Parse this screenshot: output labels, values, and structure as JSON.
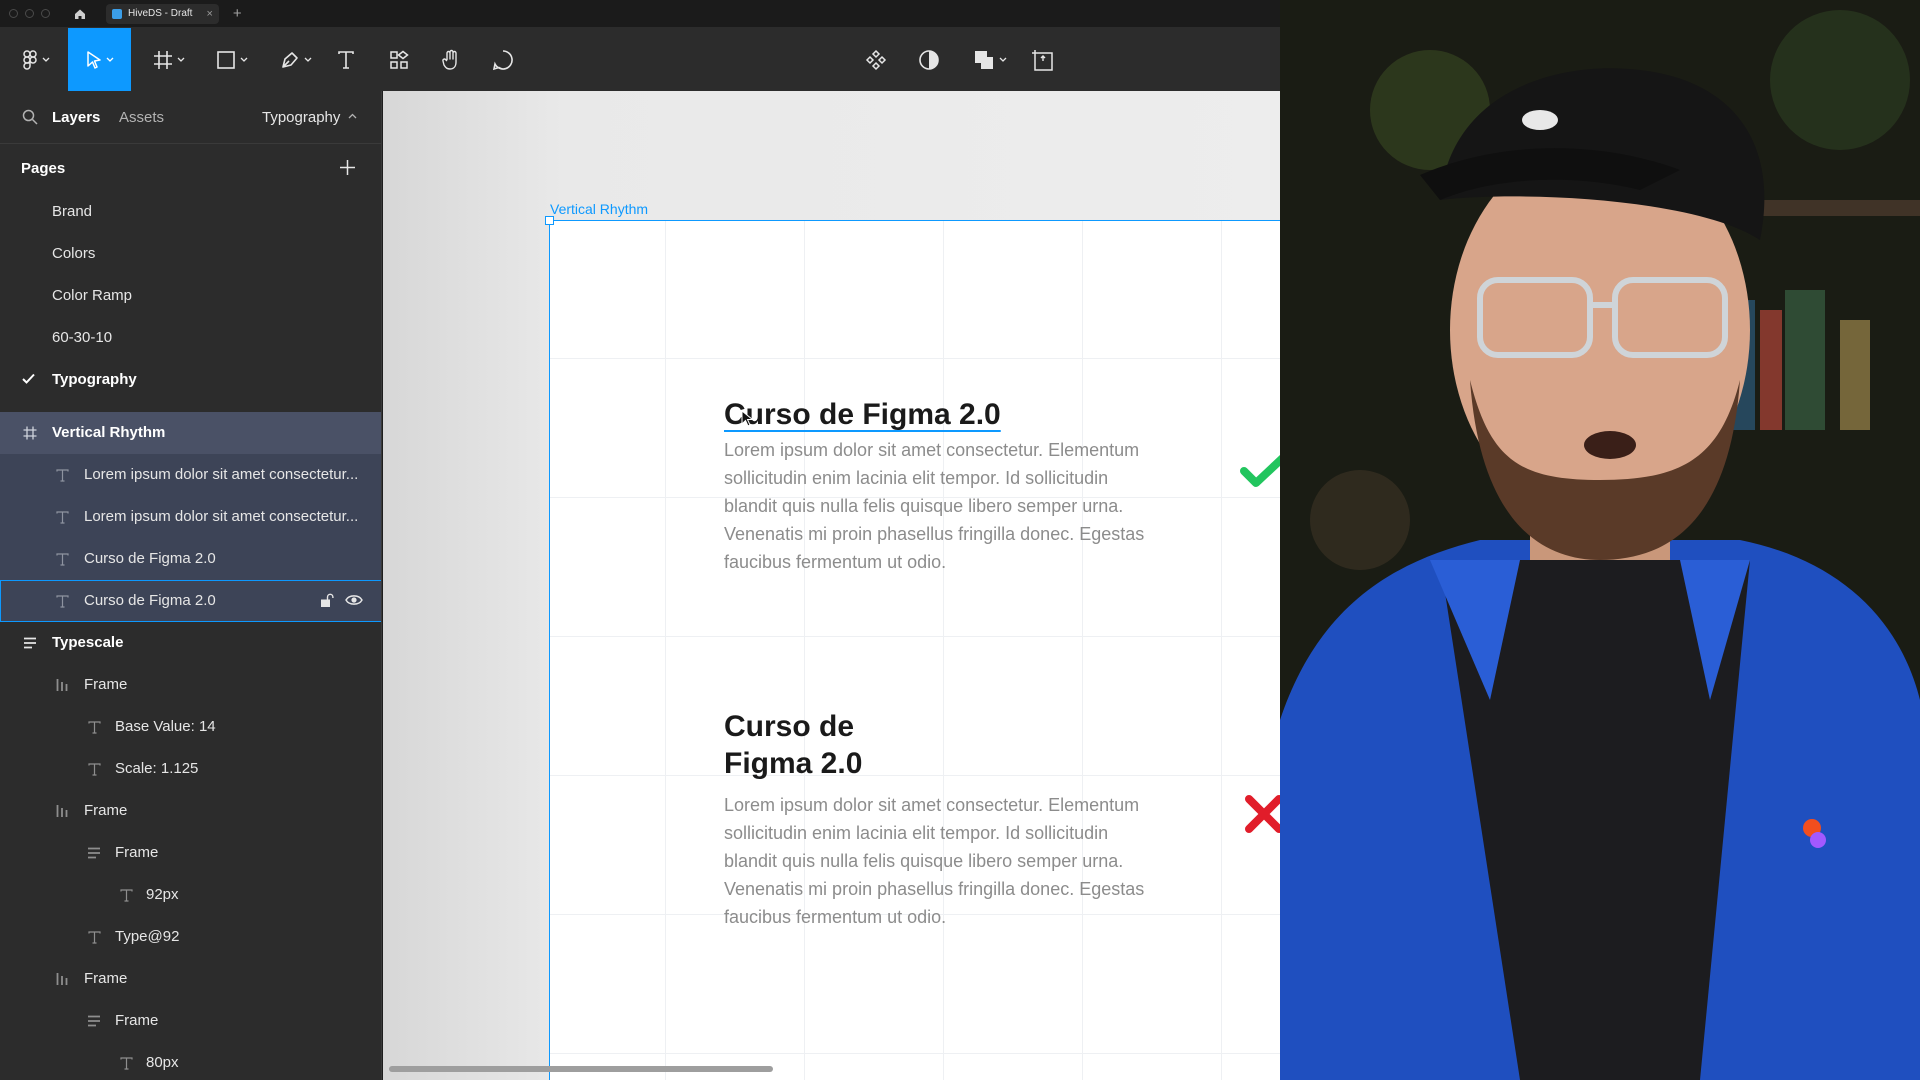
{
  "browser": {
    "tab_title": "HiveDS - Draft",
    "tab_close": "×",
    "tab_add": "+"
  },
  "toolbar": {
    "tools": [
      "main-menu",
      "move",
      "frame",
      "shape",
      "pen",
      "text",
      "resources",
      "hand",
      "comment",
      "components",
      "contrast",
      "boolean",
      "crop"
    ],
    "active_tool": "move"
  },
  "left_panel": {
    "tabs": {
      "layers": "Layers",
      "assets": "Assets"
    },
    "current_page": "Typography",
    "pages_heading": "Pages",
    "pages": [
      {
        "label": "Brand"
      },
      {
        "label": "Colors"
      },
      {
        "label": "Color Ramp"
      },
      {
        "label": "60-30-10"
      },
      {
        "label": "Typography",
        "current": true
      }
    ],
    "layers": [
      {
        "label": "Vertical Rhythm",
        "icon": "frame-icon",
        "depth": 0
      },
      {
        "label": "Lorem ipsum dolor sit amet consectetur...",
        "icon": "text-icon",
        "depth": 1
      },
      {
        "label": "Lorem ipsum dolor sit amet consectetur...",
        "icon": "text-icon",
        "depth": 1
      },
      {
        "label": "Curso de Figma 2.0",
        "icon": "text-icon",
        "depth": 1
      },
      {
        "label": "Curso de Figma 2.0",
        "icon": "text-icon",
        "depth": 1
      },
      {
        "label": "Typescale",
        "icon": "vertical-layout-icon",
        "depth": 0
      },
      {
        "label": "Frame",
        "icon": "horizontal-layout-icon",
        "depth": 1
      },
      {
        "label": "Base Value: 14",
        "icon": "text-icon",
        "depth": 2
      },
      {
        "label": "Scale: 1.125",
        "icon": "text-icon",
        "depth": 2
      },
      {
        "label": "Frame",
        "icon": "horizontal-layout-icon",
        "depth": 1
      },
      {
        "label": "Frame",
        "icon": "vertical-layout-icon",
        "depth": 2
      },
      {
        "label": "92px",
        "icon": "text-icon",
        "depth": 3
      },
      {
        "label": "Type@92",
        "icon": "text-icon",
        "depth": 2
      },
      {
        "label": "Frame",
        "icon": "horizontal-layout-icon",
        "depth": 1
      },
      {
        "label": "Frame",
        "icon": "vertical-layout-icon",
        "depth": 2
      },
      {
        "label": "80px",
        "icon": "text-icon",
        "depth": 3
      }
    ]
  },
  "canvas": {
    "frame_label": "Vertical Rhythm",
    "good_example": {
      "title": "Curso de Figma 2.0",
      "body": "Lorem ipsum dolor sit amet consectetur. Elementum sollicitudin enim lacinia elit tempor. Id sollicitudin blandit quis nulla felis quisque libero semper urna. Venenatis mi proin phasellus fringilla donec. Egestas faucibus fermentum ut odio."
    },
    "bad_example": {
      "title_line1": "Curso de",
      "title_line2": "Figma 2.0",
      "body": "Lorem ipsum dolor sit amet consectetur. Elementum sollicitudin enim lacinia elit tempor. Id sollicitudin blandit quis nulla felis quisque libero semper urna. Venenatis mi proin phasellus fringilla donec. Egestas faucibus fermentum ut odio."
    }
  },
  "colors": {
    "accent": "#0d99ff",
    "check": "#22c55e",
    "cross": "#e11d2a"
  }
}
